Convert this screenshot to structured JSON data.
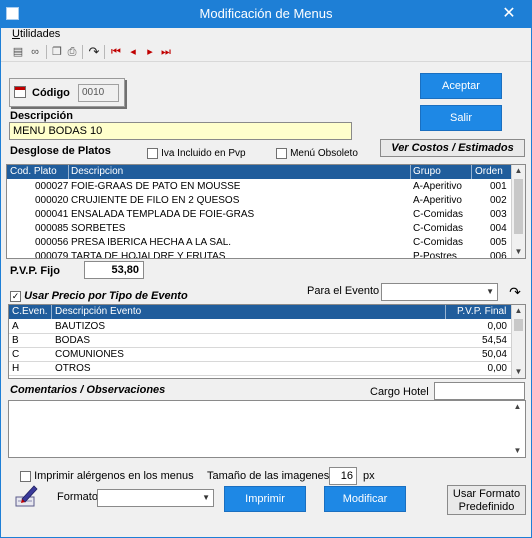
{
  "window": {
    "title": "Modificación de Menus",
    "close_glyph": "✕"
  },
  "menu": {
    "utilidades_first": "U",
    "utilidades_rest": "tilidades"
  },
  "toolbar": {
    "icons": [
      "save-icon",
      "binoculars-icon",
      "copy-icon",
      "print-icon",
      "redo-arrow-icon",
      "first-record-icon",
      "prev-record-icon",
      "next-record-icon",
      "last-record-icon"
    ],
    "glyphs": {
      "save": "▤",
      "binoculars": "∞",
      "copy": "❐",
      "print": "⎙",
      "redo": "↷",
      "first": "⏮",
      "prev": "◂",
      "next": "▸",
      "last": "⏭"
    }
  },
  "codigo": {
    "label": "Código",
    "value": "0010"
  },
  "buttons": {
    "aceptar": "Aceptar",
    "salir": "Salir",
    "ver_costos": "Ver Costos / Estimados",
    "imprimir": "Imprimir",
    "modificar": "Modificar",
    "usar_formato_1": "Usar Formato",
    "usar_formato_2": "Predefinido"
  },
  "descripcion": {
    "label": "Descripción",
    "value": "MENU BODAS 10"
  },
  "desglose": {
    "label": "Desglose de Platos",
    "iva_label": "Iva Incluido en Pvp",
    "obsoleto_label": "Menú Obsoleto"
  },
  "platos": {
    "headers": [
      "Cod. Plato",
      "Descripcion",
      "Grupo",
      "Orden"
    ],
    "rows": [
      {
        "cod": "000027",
        "desc": "FOIE-GRAAS DE PATO EN MOUSSE",
        "grupo": "A-Aperitivo",
        "orden": "001"
      },
      {
        "cod": "000020",
        "desc": "CRUJIENTE DE FILO EN 2  QUESOS",
        "grupo": "A-Aperitivo",
        "orden": "002"
      },
      {
        "cod": "000041",
        "desc": "ENSALADA TEMPLADA DE FOIE-GRAS",
        "grupo": "C-Comidas",
        "orden": "003"
      },
      {
        "cod": "000085",
        "desc": "SORBETES",
        "grupo": "C-Comidas",
        "orden": "004"
      },
      {
        "cod": "000056",
        "desc": "PRESA IBERICA HECHA A LA SAL.",
        "grupo": "C-Comidas",
        "orden": "005"
      },
      {
        "cod": "000079",
        "desc": "TARTA DE HOJALDRE Y FRUTAS",
        "grupo": "P-Postres",
        "orden": "006"
      }
    ]
  },
  "pvp": {
    "label": "P.V.P. Fijo",
    "value": "53,80"
  },
  "evento": {
    "usar_precio_label": "Usar Precio por Tipo de Evento",
    "para_evento_label": "Para el Evento",
    "para_evento_value": "",
    "headers": [
      "C.Even.",
      "Descripción Evento",
      "P.V.P. Final"
    ],
    "rows": [
      {
        "code": "A",
        "desc": "BAUTIZOS",
        "pvp": "0,00"
      },
      {
        "code": "B",
        "desc": "BODAS",
        "pvp": "54,54"
      },
      {
        "code": "C",
        "desc": "COMUNIONES",
        "pvp": "50,04"
      },
      {
        "code": "H",
        "desc": "OTROS",
        "pvp": "0,00"
      }
    ]
  },
  "comentarios": {
    "label": "Comentarios / Observaciones",
    "cargo_label": "Cargo Hotel",
    "cargo_value": "",
    "text": ""
  },
  "bottom": {
    "alergenos_label": "Imprimir alérgenos en los menus",
    "tamano_label": "Tamaño de las imagenes",
    "tamano_value": "16",
    "px_label": "px",
    "formato_label": "Formato",
    "formato_value": ""
  },
  "colors": {
    "titlebar": "#1e7fd6",
    "grid_header": "#205d9c",
    "button_blue": "#1e88e5",
    "input_yellow": "#ffffcc"
  }
}
